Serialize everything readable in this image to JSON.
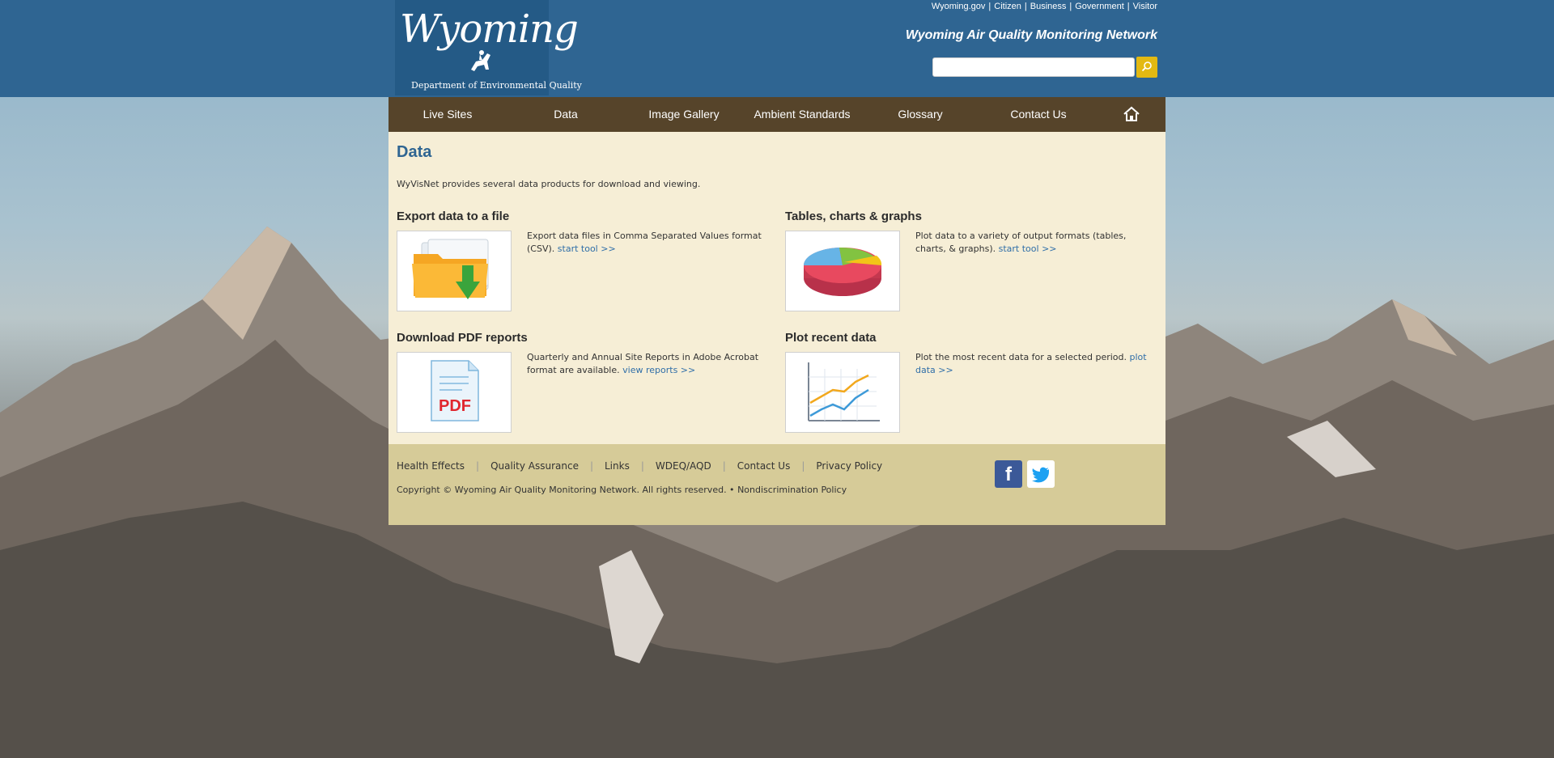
{
  "header": {
    "logo_script": "Wyoming",
    "logo_dept": "Department of Environmental Quality",
    "top_links": [
      "Wyoming.gov",
      "Citizen",
      "Business",
      "Government",
      "Visitor"
    ],
    "site_title": "Wyoming Air Quality Monitoring Network",
    "search": {
      "placeholder": "",
      "value": ""
    }
  },
  "nav": {
    "items": [
      "Live Sites",
      "Data",
      "Image Gallery",
      "Ambient Standards",
      "Glossary",
      "Contact Us"
    ],
    "home_icon": "home-icon"
  },
  "main": {
    "title": "Data",
    "intro": "WyVisNet provides several data products for download and viewing.",
    "cards": [
      {
        "title": "Export data to a file",
        "desc": "Export data files in Comma Separated Values format (CSV).",
        "link": "start tool  >>",
        "icon": "folder-download-icon"
      },
      {
        "title": "Tables, charts & graphs",
        "desc": "Plot data to a variety of output formats (tables, charts, & graphs).",
        "link": "start tool  >>",
        "icon": "pie-chart-icon"
      },
      {
        "title": "Download PDF reports",
        "desc": "Quarterly and Annual Site Reports in Adobe Acrobat format are available.",
        "link": "view reports  >>",
        "icon": "pdf-icon"
      },
      {
        "title": "Plot recent data",
        "desc": "Plot the most recent data for a selected period.",
        "link": "plot data  >>",
        "icon": "line-chart-icon"
      }
    ]
  },
  "footer": {
    "links": [
      "Health Effects",
      "Quality Assurance",
      "Links",
      "WDEQ/AQD",
      "Contact Us",
      "Privacy Policy"
    ],
    "copyright": "Copyright © Wyoming Air Quality Monitoring Network. All rights reserved. •",
    "nondiscrimination": "Nondiscrimination Policy",
    "facebook_letter": "f"
  },
  "colors": {
    "header_blue": "#2f6592",
    "nav_brown": "#56442a",
    "content_bg": "#f6eed6",
    "footer_bg": "#d6cb98",
    "accent_yellow": "#e3b912",
    "link_blue": "#2f6ea8"
  }
}
